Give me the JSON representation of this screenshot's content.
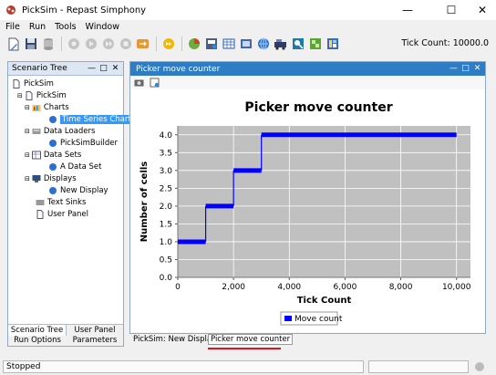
{
  "window": {
    "title": "PickSim - Repast Simphony"
  },
  "menu": {
    "items": [
      "File",
      "Run",
      "Tools",
      "Window"
    ]
  },
  "toolbar": {
    "buttons": [
      "new-icon",
      "save-icon",
      "database-icon",
      "initialize-icon",
      "start-icon",
      "step-icon",
      "stop-icon",
      "reset-icon",
      "gui-run-icon",
      "chart-icon",
      "snapshot-icon",
      "spreadsheet-icon",
      "video-icon",
      "web-icon",
      "batch-icon",
      "search-icon",
      "model-icon",
      "help-icon"
    ],
    "tick_label": "Tick Count: 10000.0"
  },
  "scenario": {
    "title": "Scenario Tree",
    "root": "PickSim",
    "model": "PickSim",
    "charts": "Charts",
    "chart_item": "Time Series Chart",
    "data_loaders": "Data Loaders",
    "loader_item": "PickSimBuilder",
    "data_sets": "Data Sets",
    "dataset_item": "A Data Set",
    "displays": "Displays",
    "display_item": "New Display",
    "text_sinks": "Text Sinks",
    "user_panel": "User Panel",
    "tabs": [
      "Scenario Tree",
      "User Panel",
      "Run Options",
      "Parameters"
    ]
  },
  "chart_panel": {
    "title": "Picker move counter",
    "bottom_tabs": [
      "PickSim: New Display",
      "Picker move counter"
    ]
  },
  "chart_data": {
    "type": "line",
    "title": "Picker move counter",
    "xlabel": "Tick Count",
    "ylabel": "Number of cells",
    "xlim": [
      0,
      10500
    ],
    "ylim": [
      0,
      4.25
    ],
    "x_ticks": [
      0,
      2000,
      4000,
      6000,
      8000,
      10000
    ],
    "x_tick_labels": [
      "0",
      "2,000",
      "4,000",
      "6,000",
      "8,000",
      "10,000"
    ],
    "y_ticks": [
      0,
      0.5,
      1,
      1.5,
      2,
      2.5,
      3,
      3.5,
      4
    ],
    "y_tick_labels": [
      "0.0",
      "0.5",
      "1.0",
      "1.5",
      "2.0",
      "2.5",
      "3.0",
      "3.5",
      "4.0"
    ],
    "grid": true,
    "legend": "bottom-center",
    "series": [
      {
        "name": "Move count",
        "color": "#0000ff",
        "x": [
          0,
          1000,
          1000,
          2000,
          2000,
          3000,
          3000,
          10000
        ],
        "y": [
          1,
          1,
          2,
          2,
          3,
          3,
          4,
          4
        ]
      }
    ]
  },
  "status": {
    "text": "Stopped"
  }
}
